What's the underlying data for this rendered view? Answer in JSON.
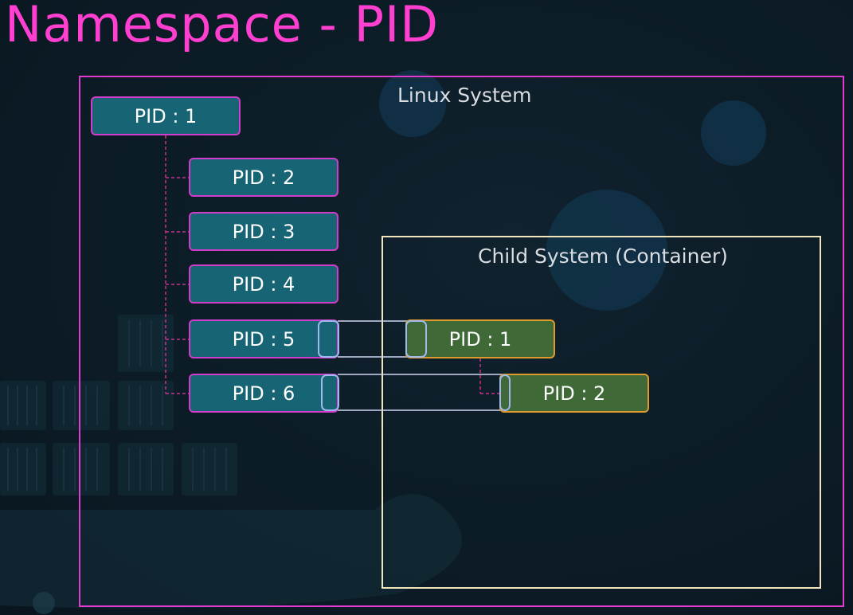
{
  "title": "Namespace - PID",
  "linux_system": {
    "label": "Linux System",
    "processes": [
      {
        "label": "PID : 1"
      },
      {
        "label": "PID : 2"
      },
      {
        "label": "PID : 3"
      },
      {
        "label": "PID : 4"
      },
      {
        "label": "PID : 5"
      },
      {
        "label": "PID : 6"
      }
    ]
  },
  "child_system": {
    "label": "Child System (Container)",
    "processes": [
      {
        "label": "PID : 1"
      },
      {
        "label": "PID : 2"
      }
    ]
  },
  "colors": {
    "title": "#ff3fd0",
    "host_process_fill": "#176474",
    "host_process_border": "#d23ccb",
    "container_process_fill": "#3f6a38",
    "container_process_border": "#e09a2b",
    "linux_frame": "#e13bd2",
    "child_frame": "#f2e4bd",
    "mapping_link": "#9fb8ee",
    "tree_connector": "#c8308f"
  }
}
